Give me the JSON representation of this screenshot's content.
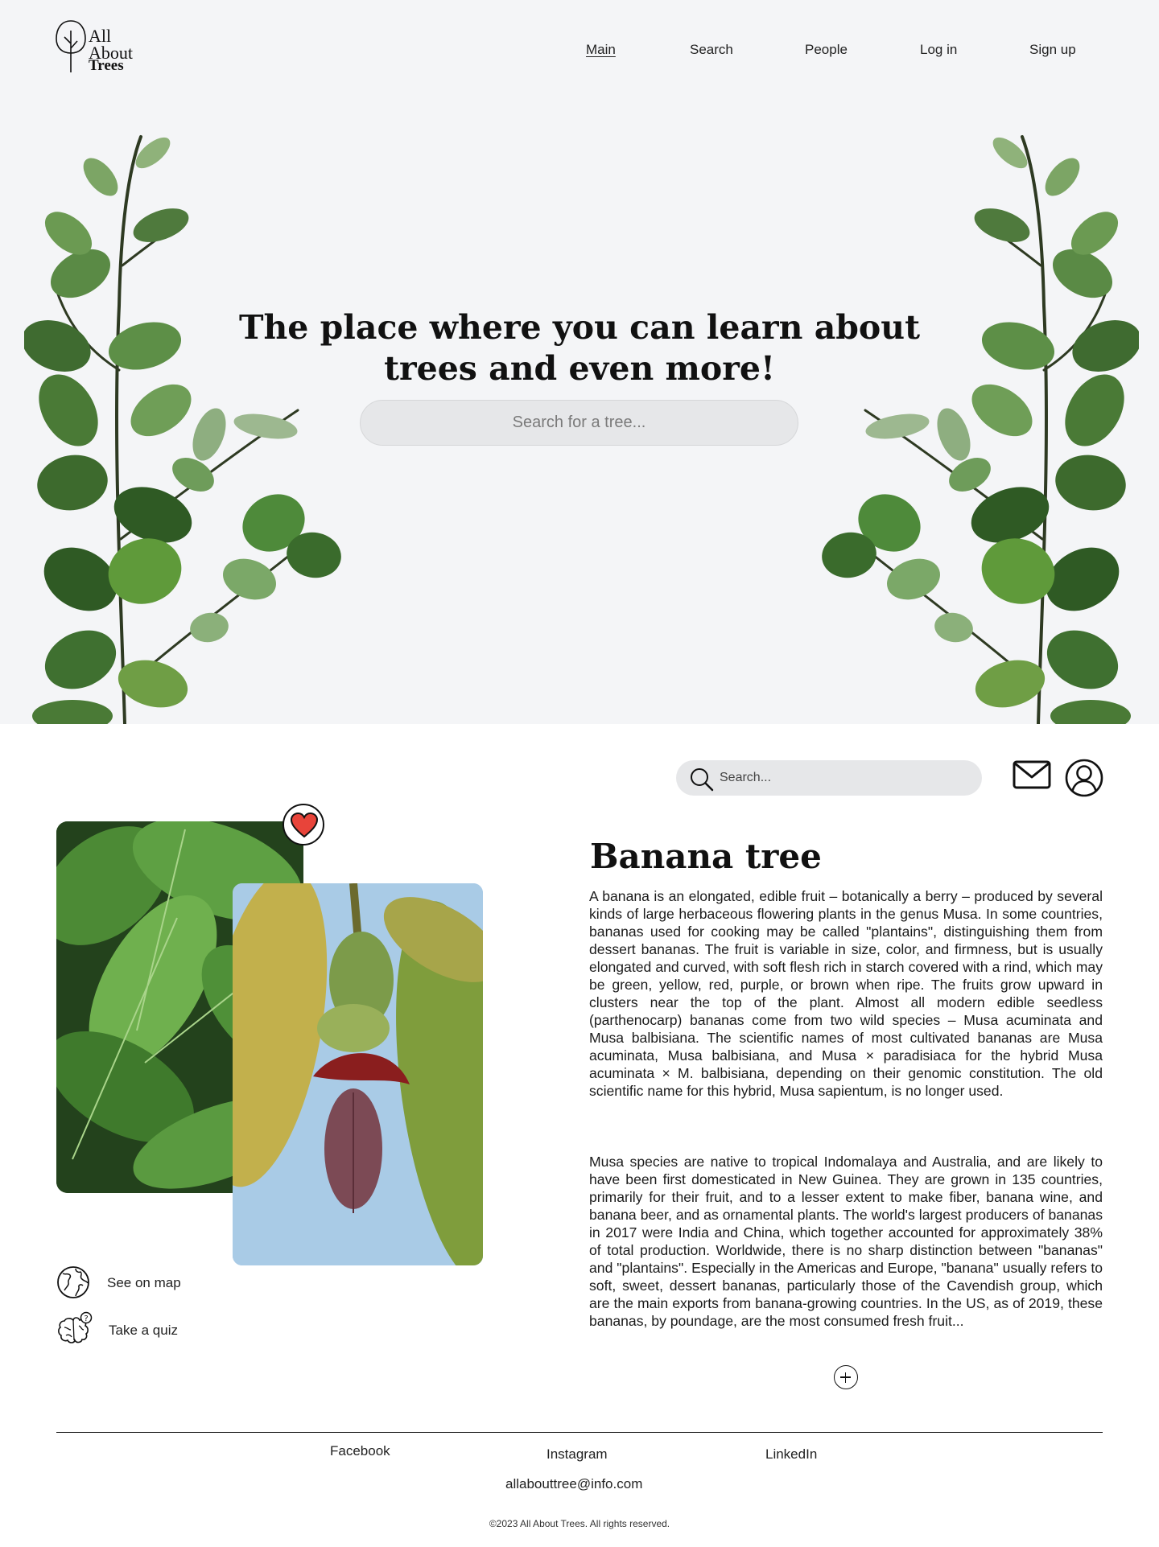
{
  "brand": {
    "line1": "All",
    "line2": "About",
    "line3": "Trees"
  },
  "nav": {
    "items": [
      {
        "label": "Main",
        "active": true
      },
      {
        "label": "Search"
      },
      {
        "label": "People"
      },
      {
        "label": "Log in"
      },
      {
        "label": "Sign up"
      }
    ]
  },
  "hero": {
    "title": "The place where you can learn about trees and even more!",
    "search_placeholder": "Search for a tree..."
  },
  "toolbar": {
    "search_placeholder": "Search...",
    "icons": [
      "search-icon",
      "mail-icon",
      "user-icon"
    ]
  },
  "tree": {
    "title": "Banana tree",
    "favorite_icon": "heart-icon",
    "description": [
      "A banana is an elongated, edible fruit – botanically a berry – produced by several kinds of large herbaceous flowering plants in the genus Musa. In some countries, bananas used for cooking may be called \"plantains\", distinguishing them from dessert bananas. The fruit is variable in size, color, and firmness, but is usually elongated and curved, with soft flesh rich in starch covered with a rind, which may be green, yellow, red, purple, or brown when ripe. The fruits grow upward in clusters near the top of the plant. Almost all modern edible seedless (parthenocarp) bananas come from two wild species – Musa acuminata and Musa balbisiana. The scientific names of most cultivated bananas are Musa acuminata, Musa balbisiana, and Musa × paradisiaca for the hybrid Musa acuminata × M. balbisiana, depending on their genomic constitution. The old scientific name for this hybrid, Musa sapientum, is no longer used.",
      "Musa species are native to tropical Indomalaya and Australia, and are likely to have been first domesticated in New Guinea. They are grown in 135 countries, primarily for their fruit, and to a lesser extent to make fiber, banana wine, and banana beer, and as ornamental plants. The world's largest producers of bananas in 2017 were India and China, which together accounted for approximately 38% of total production. Worldwide, there is no sharp distinction between \"bananas\" and \"plantains\". Especially in the Americas and Europe, \"banana\" usually refers to soft, sweet, dessert bananas, particularly those of the Cavendish group, which are the main exports from banana-growing countries. In the US, as of 2019, these bananas, by poundage, are the most consumed fresh fruit..."
    ]
  },
  "actions": [
    {
      "label": "See on map",
      "icon": "globe-icon"
    },
    {
      "label": "Take a quiz",
      "icon": "brain-question-icon"
    }
  ],
  "footer": {
    "links": [
      "Facebook",
      "Instagram",
      "LinkedIn"
    ],
    "email": "allabouttree@info.com",
    "copyright": "©2023 All About Trees. All rights reserved."
  },
  "colors": {
    "hero_bg": "#f4f5f7",
    "search_bg": "#e6e7e9",
    "leaf_green": "#4f7a3d",
    "heart_red": "#e8443a"
  }
}
